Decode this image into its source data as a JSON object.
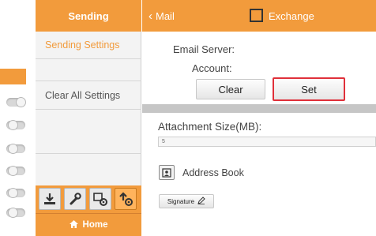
{
  "left_panel": {
    "toggles": [
      {
        "state": "on"
      },
      {
        "state": "off"
      },
      {
        "state": "off"
      },
      {
        "state": "off"
      },
      {
        "state": "off"
      },
      {
        "state": "off"
      }
    ]
  },
  "sidebar": {
    "header": "Sending",
    "items": [
      {
        "label": "Sending Settings",
        "active": true
      },
      {
        "label": "",
        "active": false
      },
      {
        "label": "Clear All Settings",
        "active": false
      },
      {
        "label": "",
        "active": false
      },
      {
        "label": "",
        "active": false
      }
    ],
    "toolbar_icons": [
      "download-icon",
      "wrench-icon",
      "settings-gear-icon",
      "upload-settings-icon"
    ],
    "home_label": "Home"
  },
  "header": {
    "back_label": "Mail",
    "exchange_label": "Exchange",
    "exchange_checked": false
  },
  "email": {
    "server_label": "Email Server:",
    "account_label": "Account:",
    "clear_label": "Clear",
    "set_label": "Set"
  },
  "attachment": {
    "label": "Attachment Size(MB):",
    "value": "5"
  },
  "address_book": {
    "label": "Address Book"
  },
  "signature": {
    "label": "Signature"
  },
  "colors": {
    "accent": "#f29b3c",
    "highlight": "#e0303a"
  }
}
